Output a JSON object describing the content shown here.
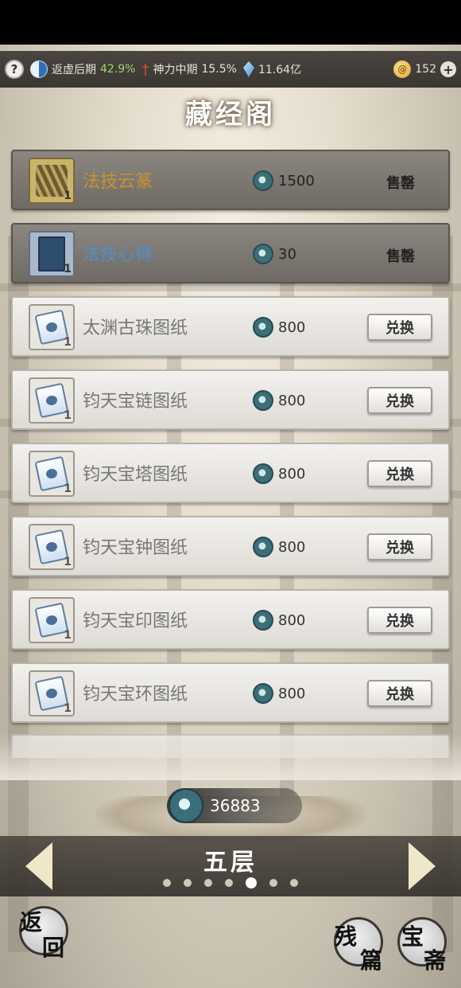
{
  "topbar": {
    "cultivation_label": "返虚后期",
    "cultivation_pct": "42.9%",
    "divine_label": "神力中期",
    "divine_pct": "15.5%",
    "crystals": "11.64亿",
    "coins": "152",
    "help": "?",
    "plus": "+"
  },
  "title": "藏经阁",
  "items": [
    {
      "name": "法技云篆",
      "qty": "1",
      "price": "1500",
      "status": "售罄",
      "sold": true,
      "theme": "gold",
      "icon": "bamboo-scroll-icon"
    },
    {
      "name": "法技心得",
      "qty": "1",
      "price": "30",
      "status": "售罄",
      "sold": true,
      "theme": "blue",
      "icon": "book-icon"
    },
    {
      "name": "太渊古珠图纸",
      "qty": "1",
      "price": "800",
      "action": "兑换",
      "icon": "blueprint-scroll-icon"
    },
    {
      "name": "钧天宝链图纸",
      "qty": "1",
      "price": "800",
      "action": "兑换",
      "icon": "blueprint-scroll-icon"
    },
    {
      "name": "钧天宝塔图纸",
      "qty": "1",
      "price": "800",
      "action": "兑换",
      "icon": "blueprint-scroll-icon"
    },
    {
      "name": "钧天宝钟图纸",
      "qty": "1",
      "price": "800",
      "action": "兑换",
      "icon": "blueprint-scroll-icon"
    },
    {
      "name": "钧天宝印图纸",
      "qty": "1",
      "price": "800",
      "action": "兑换",
      "icon": "blueprint-scroll-icon"
    },
    {
      "name": "钧天宝环图纸",
      "qty": "1",
      "price": "800",
      "action": "兑换",
      "icon": "blueprint-scroll-icon"
    }
  ],
  "currency_amount": "36883",
  "floor": {
    "name": "五层",
    "page_count": 7,
    "active_page": 5
  },
  "buttons": {
    "back": [
      "返",
      "回"
    ],
    "fragments": [
      "残",
      "篇"
    ],
    "treasure": [
      "宝",
      "斋"
    ]
  }
}
